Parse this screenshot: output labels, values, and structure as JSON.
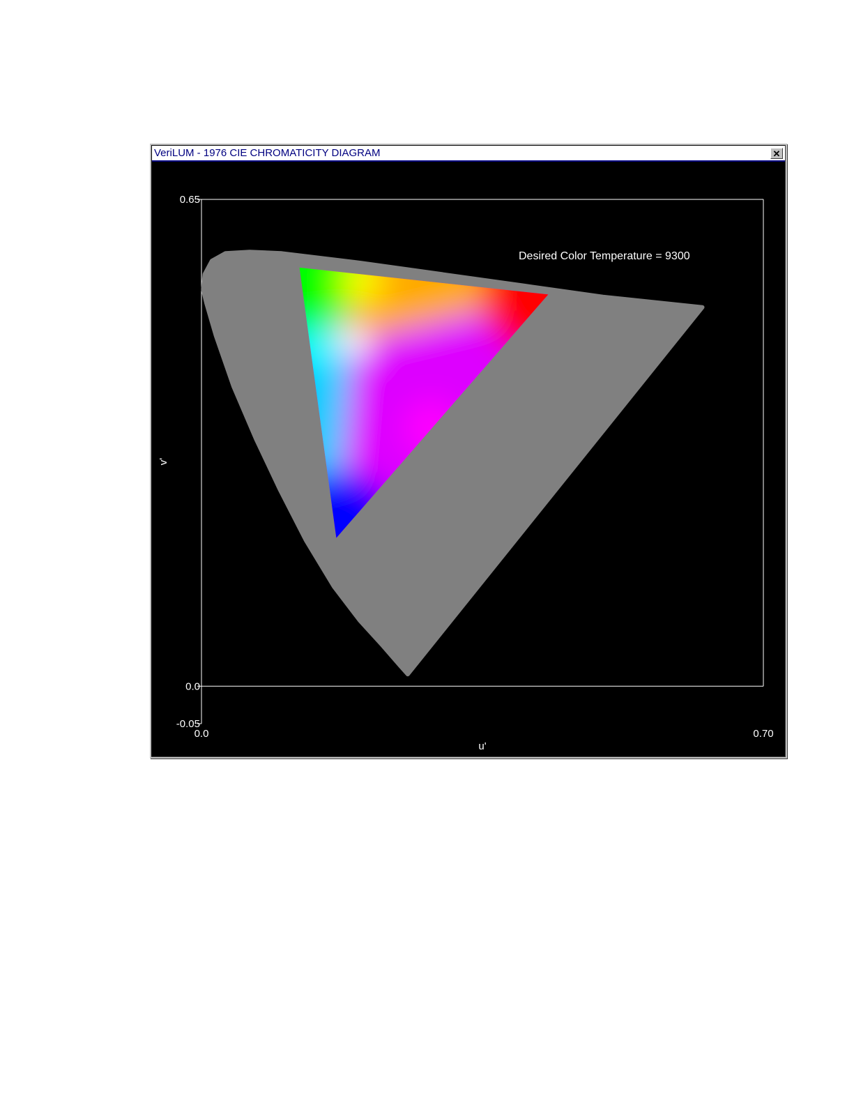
{
  "window": {
    "title": "VeriLUM - 1976 CIE CHROMATICITY DIAGRAM",
    "close_glyph": "✕",
    "close_icon": "close-icon"
  },
  "chart_data": {
    "type": "scatter",
    "title": "",
    "annotation": "Desired Color Temperature = 9300",
    "xlabel": "u'",
    "ylabel": "v'",
    "xlim": [
      0.0,
      0.7
    ],
    "ylim": [
      -0.05,
      0.65
    ],
    "x_ticks": [
      "0.0",
      "0.70"
    ],
    "y_ticks": [
      "0.65",
      "0.0",
      "-0.05"
    ],
    "grid": false,
    "spectral_locus": [
      [
        0.257,
        0.016
      ],
      [
        0.247,
        0.028
      ],
      [
        0.225,
        0.055
      ],
      [
        0.197,
        0.088
      ],
      [
        0.165,
        0.133
      ],
      [
        0.13,
        0.195
      ],
      [
        0.098,
        0.262
      ],
      [
        0.068,
        0.33
      ],
      [
        0.04,
        0.4
      ],
      [
        0.018,
        0.468
      ],
      [
        0.006,
        0.512
      ],
      [
        0.002,
        0.53
      ],
      [
        0.004,
        0.55
      ],
      [
        0.013,
        0.568
      ],
      [
        0.03,
        0.578
      ],
      [
        0.06,
        0.58
      ],
      [
        0.1,
        0.578
      ],
      [
        0.2,
        0.565
      ],
      [
        0.3,
        0.55
      ],
      [
        0.4,
        0.535
      ],
      [
        0.5,
        0.52
      ],
      [
        0.624,
        0.506
      ]
    ],
    "gamut": {
      "red": [
        0.432,
        0.523
      ],
      "green": [
        0.122,
        0.559
      ],
      "blue": [
        0.168,
        0.198
      ],
      "white": [
        0.189,
        0.46
      ]
    },
    "colors": {
      "background": "#000000",
      "locus_fill": "#808080",
      "axis": "#ffffff",
      "red": "#ff0000",
      "green": "#00ff00",
      "blue": "#0000ff"
    }
  }
}
